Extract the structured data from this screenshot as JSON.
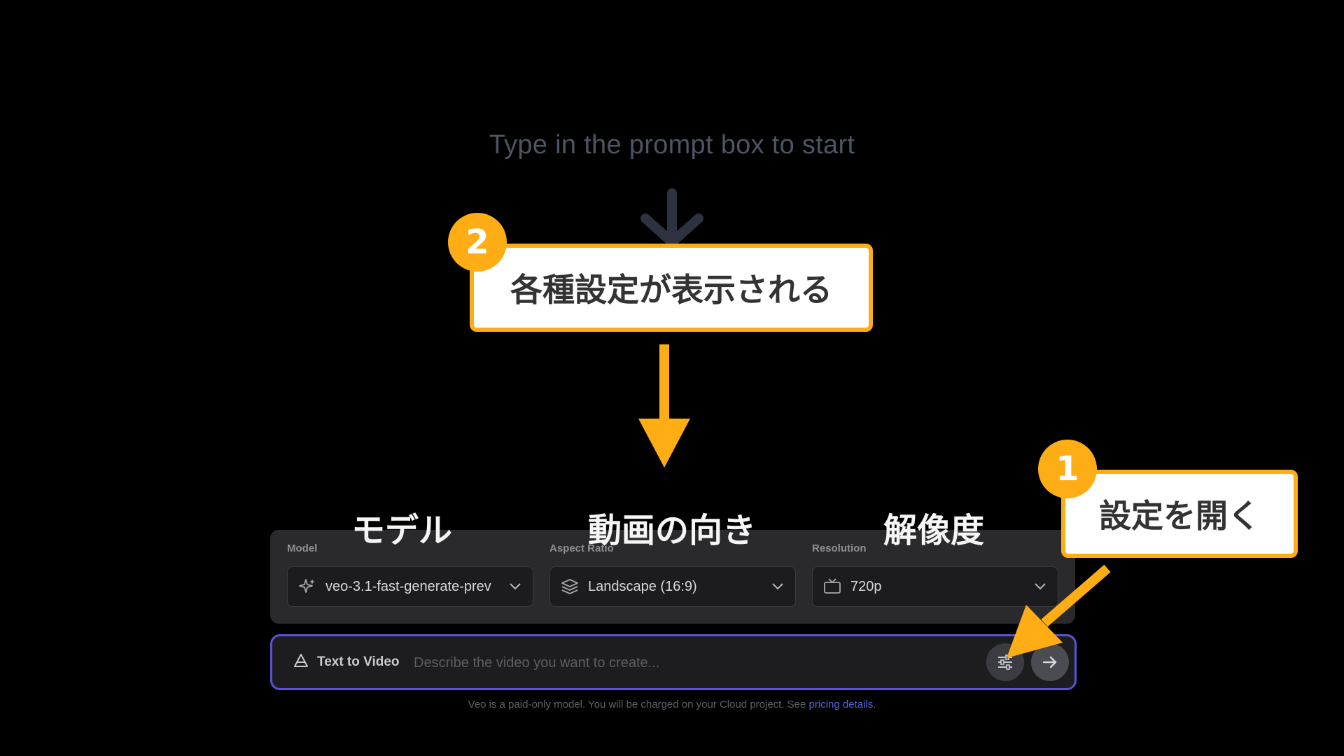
{
  "empty_state": {
    "hint": "Type in the prompt box to start"
  },
  "settings": {
    "model": {
      "label": "Model",
      "value": "veo-3.1-fast-generate-prev",
      "icon": "sparkle-icon"
    },
    "aspect_ratio": {
      "label": "Aspect Ratio",
      "value": "Landscape (16:9)",
      "icon": "layers-icon"
    },
    "resolution": {
      "label": "Resolution",
      "value": "720p",
      "icon": "tv-icon"
    }
  },
  "prompt_bar": {
    "mode_label": "Text to Video",
    "placeholder": "Describe the video you want to create...",
    "settings_icon": "sliders-icon",
    "send_icon": "arrow-right-icon"
  },
  "footnote": {
    "text": "Veo is a paid-only model. You will be charged on your Cloud project. See ",
    "link": "pricing details",
    "tail": "."
  },
  "annotations": {
    "step1": {
      "number": "1",
      "text": "設定を開く"
    },
    "step2": {
      "number": "2",
      "text": "各種設定が表示される"
    },
    "captions": {
      "model": "モデル",
      "aspect": "動画の向き",
      "resolution": "解像度"
    },
    "accent_color": "#ffad15"
  },
  "colors": {
    "background": "#000000",
    "prompt_border": "#5b52d6",
    "link": "#5a63d8"
  }
}
